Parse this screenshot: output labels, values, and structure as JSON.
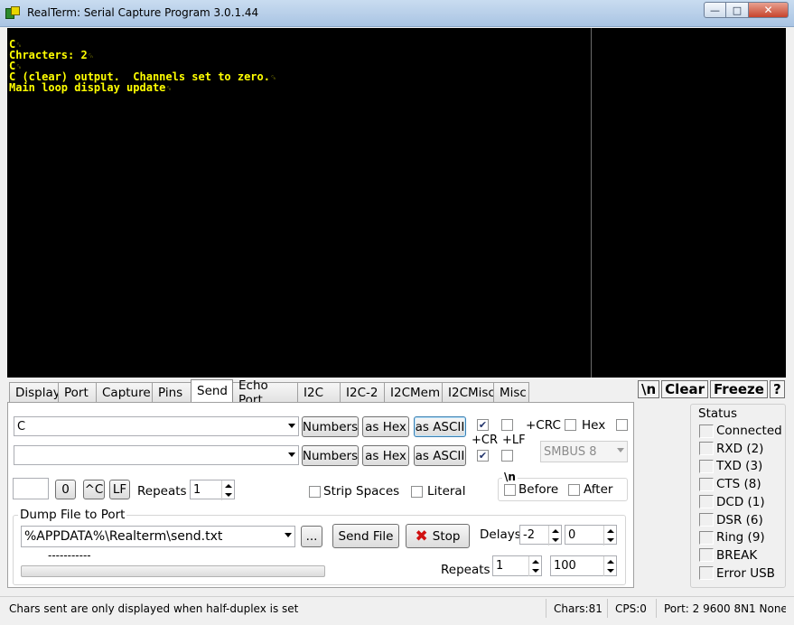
{
  "window": {
    "title": "RealTerm: Serial Capture Program 3.0.1.44"
  },
  "terminal": {
    "lines": [
      "C",
      "Chracters: 2",
      "C",
      "C (clear) output.  Channels set to zero.",
      "Main loop display update"
    ]
  },
  "tabs": [
    "Display",
    "Port",
    "Capture",
    "Pins",
    "Send",
    "Echo Port",
    "I2C",
    "I2C-2",
    "I2CMem",
    "I2CMisc",
    "Misc"
  ],
  "active_tab": "Send",
  "toolbar": {
    "newline": "\\n",
    "clear": "Clear",
    "freeze": "Freeze",
    "help": "?"
  },
  "send": {
    "line1": {
      "value": "C"
    },
    "line2": {
      "value": ""
    },
    "numbers_label": "Numbers",
    "as_hex_label": "as Hex",
    "as_ascii_label": "as ASCII",
    "cr_label": "+CR",
    "lf_label": "+LF",
    "crc_label": "+CRC",
    "hex_label": "Hex",
    "smbus_value": "SMBUS 8",
    "newline_group_label": "\\n",
    "before_label": "Before",
    "after_label": "After",
    "char_value": "",
    "zero_label": "0",
    "ctrl_c_label": "^C",
    "lf_button_label": "LF",
    "repeats_label": "Repeats",
    "repeats_value": "1",
    "strip_spaces_label": "Strip Spaces",
    "literal_label": "Literal",
    "line1_cr_checked": true,
    "line1_lf_checked": false,
    "line2_cr_checked": true,
    "line2_lf_checked": false
  },
  "dump": {
    "title": "Dump File to Port",
    "file_path": "%APPDATA%\\Realterm\\send.txt",
    "browse_label": "...",
    "send_file_label": "Send File",
    "stop_label": "Stop",
    "delays_label": "Delays",
    "delay1": "-2",
    "delay2": "0",
    "progress_text": "-----------",
    "repeats_label": "Repeats",
    "repeats1": "1",
    "repeats2": "100"
  },
  "status": {
    "title": "Status",
    "items": [
      "Connected",
      "RXD (2)",
      "TXD (3)",
      "CTS (8)",
      "DCD (1)",
      "DSR (6)",
      "Ring (9)",
      "BREAK",
      "Error  USB"
    ]
  },
  "statusbar": {
    "message": "Chars sent are only displayed when half-duplex is set",
    "chars": "Chars:81",
    "cps": "CPS:0",
    "port": "Port: 2  9600 8N1 None"
  }
}
